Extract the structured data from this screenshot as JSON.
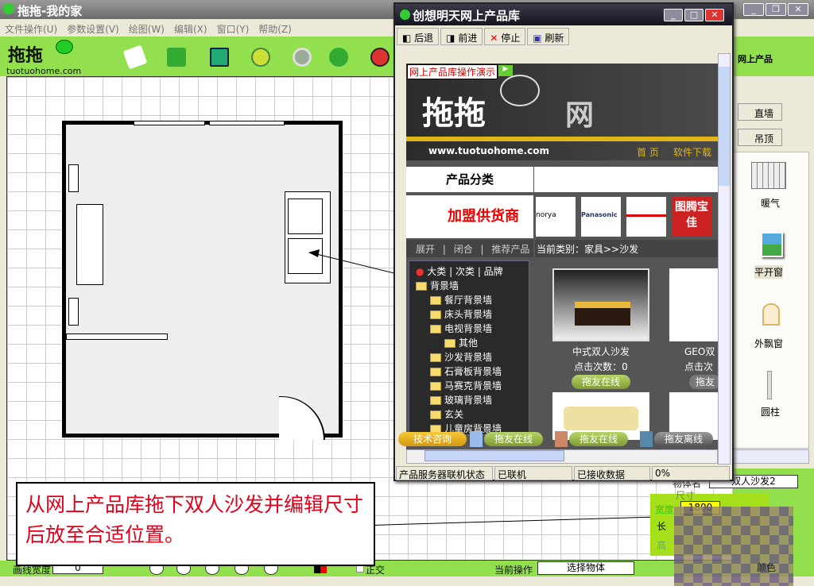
{
  "app": {
    "title": "拖拖-我的家",
    "logo_text": "tuotuohome.com"
  },
  "menu": [
    "文件操作(U)",
    "参数设置(V)",
    "绘图(W)",
    "编辑(X)",
    "窗口(Y)",
    "帮助(Z)"
  ],
  "toolbar_icons": [
    "new-icon",
    "book-icon",
    "save-icon",
    "pointer-icon",
    "rotate-icon",
    "refresh-icon",
    "close-icon"
  ],
  "status": {
    "line_width_label": "画线宽度",
    "line_width_value": "0",
    "ortho_label": "正交",
    "current_op_label": "当前操作",
    "current_op_value": "选择物体"
  },
  "right_panel": {
    "header": "网上产品",
    "buttons": [
      "直墙",
      "吊顶"
    ],
    "items": [
      "暖气",
      "平开窗",
      "外飘窗",
      "圆柱"
    ],
    "object_name_label": "物体名",
    "object_name_value": "双人沙发2",
    "size_group": "尺寸",
    "width_label": "宽度",
    "width_value": "1800",
    "length_label": "长",
    "height_label": "高",
    "color_label": "颜色"
  },
  "popup": {
    "title": "创想明天网上产品库",
    "buttons": [
      "后退",
      "前进",
      "停止",
      "刷新"
    ],
    "demo_link": "网上产品库操作演示",
    "banner_title": "网",
    "site_url": "www.tuotuohome.com",
    "nav": [
      "首 页",
      "软件下载"
    ],
    "category_header": "产品分类",
    "supplier_banner": "加盟供货商",
    "brands": [
      "norya",
      "Panasonic",
      "",
      "图腾宝佳"
    ],
    "tree_controls": [
      "展开",
      "闭合",
      "推荐产品"
    ],
    "current_category": "当前类别：家具>>沙发",
    "tree_tabs": [
      "大类",
      "次类",
      "品牌"
    ],
    "tree": [
      {
        "label": "背景墙",
        "level": 0
      },
      {
        "label": "餐厅背景墙",
        "level": 1
      },
      {
        "label": "床头背景墙",
        "level": 1
      },
      {
        "label": "电视背景墙",
        "level": 1
      },
      {
        "label": "其他",
        "level": 2
      },
      {
        "label": "沙发背景墙",
        "level": 1
      },
      {
        "label": "石膏板背景墙",
        "level": 1
      },
      {
        "label": "马赛克背景墙",
        "level": 1
      },
      {
        "label": "玻璃背景墙",
        "level": 1
      },
      {
        "label": "玄关",
        "level": 1
      },
      {
        "label": "儿童房背景墙",
        "level": 1
      }
    ],
    "products": [
      {
        "name": "中式双人沙发",
        "clicks": "点击次数：0",
        "button": "拖友在线"
      },
      {
        "name": "GEO双",
        "clicks": "点击次",
        "button": "拖友"
      }
    ],
    "chat": {
      "tech": "技术咨询",
      "online1": "拖友在线",
      "online2": "拖友在线",
      "offline": "拖友离线"
    },
    "statusbar": [
      "产品服务器联机状态",
      "已联机",
      "已接收数据",
      "0%"
    ]
  },
  "annotation": "从网上产品库拖下双人沙发并编辑尺寸后放至合适位置。",
  "colors": {
    "toolbar_green": "#93e04e",
    "annotation_red": "#e0001a"
  }
}
